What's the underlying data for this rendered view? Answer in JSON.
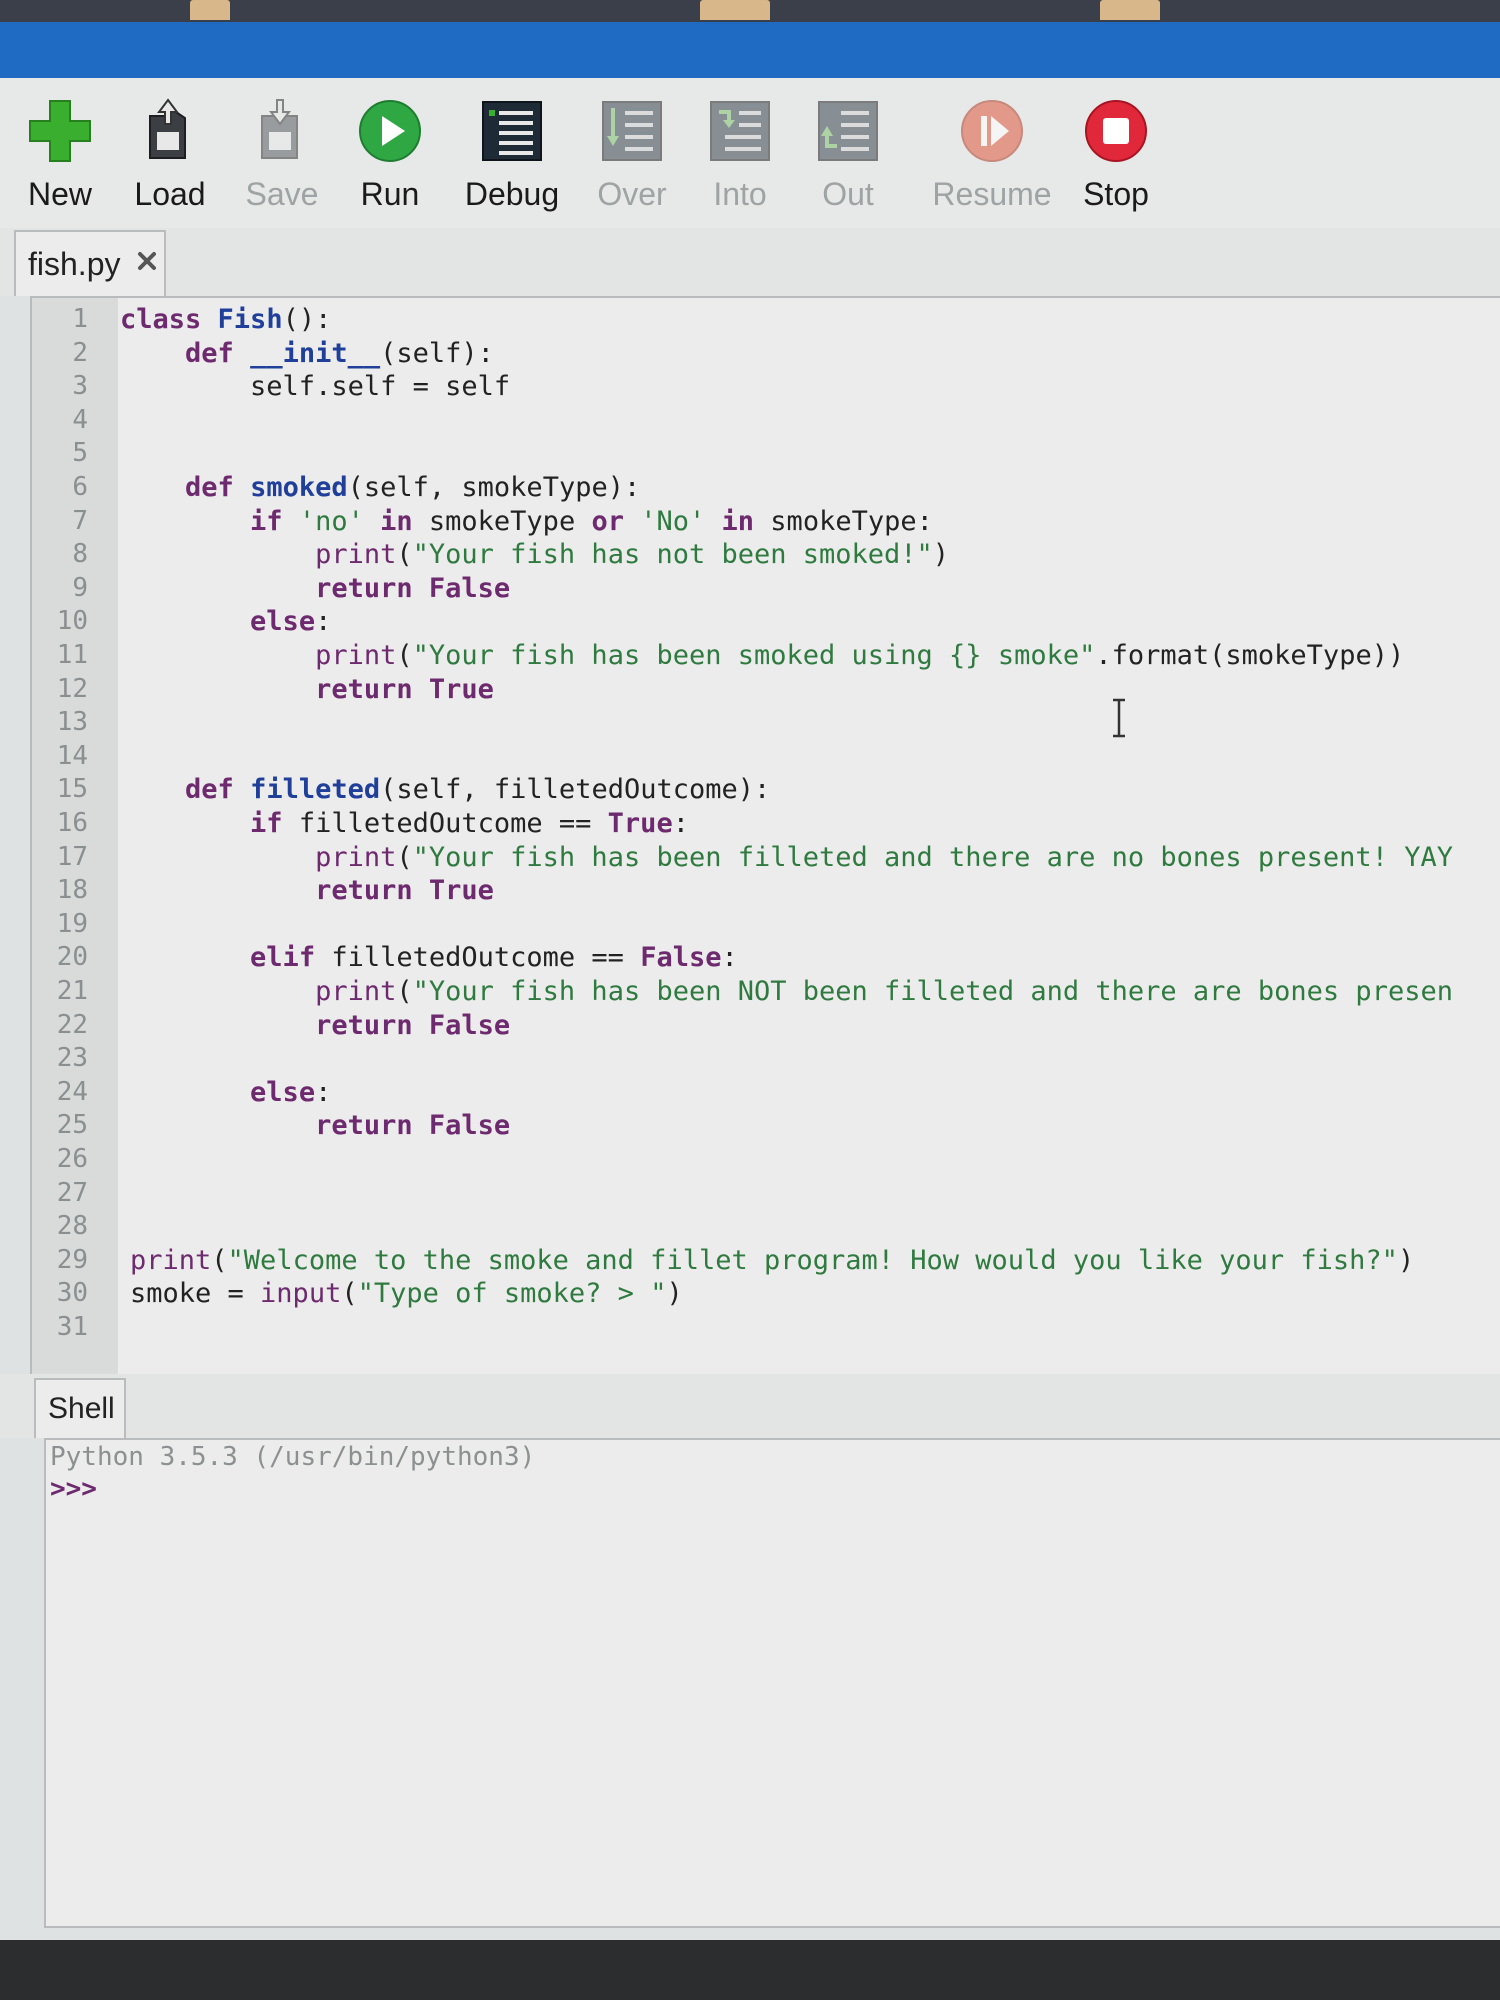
{
  "toolbar": {
    "new": "New",
    "load": "Load",
    "save": "Save",
    "run": "Run",
    "debug": "Debug",
    "over": "Over",
    "into": "Into",
    "out": "Out",
    "resume": "Resume",
    "stop": "Stop"
  },
  "editor": {
    "tab_name": "fish.py",
    "lines": [
      "class Fish():",
      "    def __init__(self):",
      "        self.self = self",
      "",
      "",
      "    def smoked(self, smokeType):",
      "        if 'no' in smokeType or 'No' in smokeType:",
      "            print(\"Your fish has not been smoked!\")",
      "            return False",
      "        else:",
      "            print(\"Your fish has been smoked using {} smoke\".format(smokeType))",
      "            return True",
      "",
      "",
      "    def filleted(self, filletedOutcome):",
      "        if filletedOutcome == True:",
      "            print(\"Your fish has been filleted and there are no bones present! YAY",
      "            return True",
      "",
      "        elif filletedOutcome == False:",
      "            print(\"Your fish has been NOT been filleted and there are bones presen",
      "            return False",
      "",
      "        else:",
      "            return False",
      "",
      "",
      "",
      "print(\"Welcome to the smoke and fillet program! How would you like your fish?\")",
      "smoke = input(\"Type of smoke? > \")",
      ""
    ]
  },
  "shell": {
    "tab_name": "Shell",
    "banner": "Python 3.5.3 (/usr/bin/python3)",
    "prompt": ">>>"
  }
}
